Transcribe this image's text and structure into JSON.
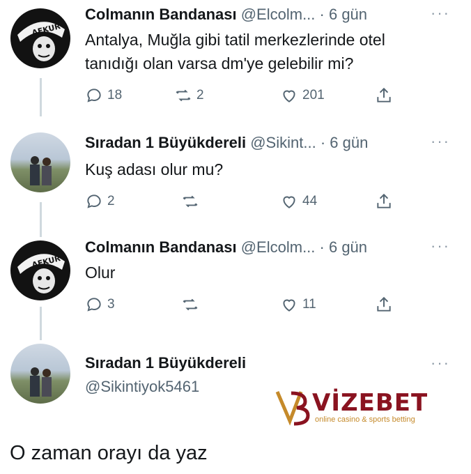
{
  "tweets": [
    {
      "name": "Colmanın Bandanası",
      "handle": "@Elcolm...",
      "time": "· 6 gün",
      "text_lines": [
        "Antalya, Muğla gibi tatil merkezlerinde otel",
        "tanıdığı olan varsa dm'ye gelebilir mi?"
      ],
      "replies": "18",
      "retweets": "2",
      "likes": "201",
      "avatar": "dark-cartoon-avatar",
      "avatar_text": "AFKUR"
    },
    {
      "name": "Sıradan 1 Büyükdereli",
      "handle": "@Sikint...",
      "time": "· 6 gün",
      "text_lines": [
        "Kuş adası olur mu?"
      ],
      "replies": "2",
      "retweets": "",
      "likes": "44",
      "avatar": "photo-avatar"
    },
    {
      "name": "Colmanın Bandanası",
      "handle": "@Elcolm...",
      "time": "· 6 gün",
      "text_lines": [
        "Olur"
      ],
      "replies": "3",
      "retweets": "",
      "likes": "11",
      "avatar": "dark-cartoon-avatar",
      "avatar_text": "AFKUR"
    },
    {
      "name": "Sıradan 1 Büyükdereli",
      "handle": "@Sikintiyok5461",
      "avatar": "photo-avatar"
    }
  ],
  "final_text": "O zaman orayı da yaz",
  "more_label": "···",
  "watermark": {
    "brand": "VİZEBET",
    "tagline": "online casino & sports betting"
  },
  "colors": {
    "text": "#14171a",
    "muted": "#536471",
    "line": "#cfd9de",
    "brand": "#8a1320",
    "brand_gold": "#c58a2a"
  }
}
